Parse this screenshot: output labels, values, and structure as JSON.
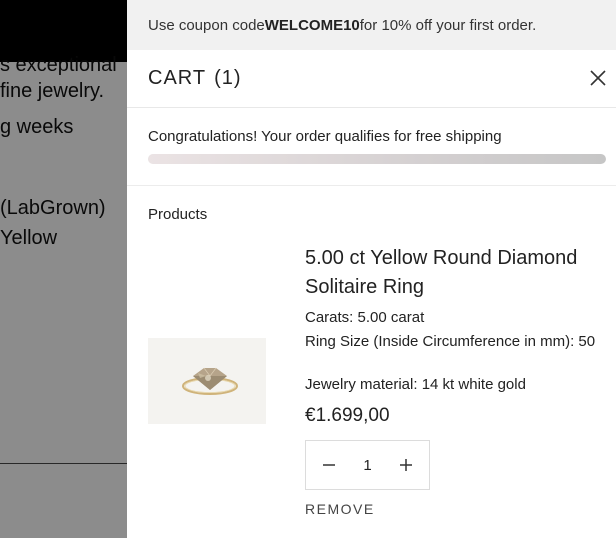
{
  "background_page": {
    "lines": [
      "s exceptional",
      "fine jewelry.",
      "g weeks",
      "(LabGrown)",
      "Yellow"
    ]
  },
  "drawer": {
    "promo": {
      "prefix": "Use coupon code ",
      "code": "WELCOME10",
      "suffix": " for 10% off your first order."
    },
    "title": "CART",
    "count": "(1)",
    "shipping_message": "Congratulations! Your order qualifies for free shipping",
    "shipping_progress": 1.0,
    "products_label": "Products",
    "product": {
      "name": "5.00 ct Yellow Round Diamond Solitaire Ring",
      "attributes": {
        "carats_label": "Carats:",
        "carats_value": "5.00 carat",
        "ring_size_label": "Ring Size (Inside Circumference in mm):",
        "ring_size_value": "50",
        "material_label": "Jewelry material:",
        "material_value": "14 kt white gold"
      },
      "price": "€1.699,00",
      "quantity": "1",
      "remove_label": "REMOVE"
    }
  },
  "colors": {
    "overlay": "#000000",
    "promo_bg": "#f1f1f1",
    "progress_fill": "#d4d0d1",
    "text": "#222222"
  },
  "icons": {
    "close": "close-icon",
    "minus": "minus-icon",
    "plus": "plus-icon"
  }
}
